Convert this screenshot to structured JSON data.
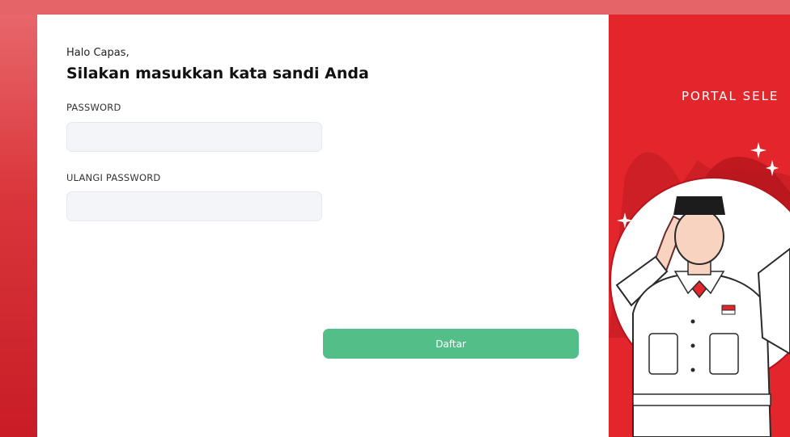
{
  "form": {
    "greeting": "Halo Capas,",
    "title": "Silakan masukkan kata sandi Anda",
    "password_label": "PASSWORD",
    "password_value": "",
    "repeat_password_label": "ULANGI PASSWORD",
    "repeat_password_value": "",
    "submit_label": "Daftar"
  },
  "side_panel": {
    "title": "PORTAL SELE"
  },
  "icons": [
    "sparkle-icon",
    "sparkle-icon",
    "sparkle-icon"
  ],
  "colors": {
    "brand_red": "#e3262c",
    "submit_green": "#52bf89",
    "input_bg": "#f4f5f8"
  }
}
